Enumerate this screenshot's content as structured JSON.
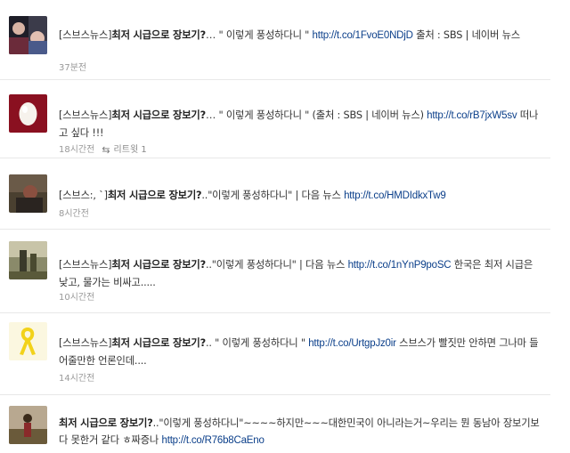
{
  "tweets": [
    {
      "text_before": "[스브스뉴스]",
      "title": "최저 시급으로 장보기?",
      "text_after": "… \" 이렇게 풍성하다니 \" ",
      "link": "http://t.co/1FvoE0NDjD",
      "text_end": " 출처 : SBS | 네이버 뉴스",
      "time": "37분전",
      "retweet": ""
    },
    {
      "text_before": "[스브스뉴스]",
      "title": "최저 시급으로 장보기?",
      "text_after": "… \" 이렇게 풍성하다니 \" (출처 : SBS | 네이버 뉴스) ",
      "link": "http://t.co/rB7jxW5sv",
      "text_end": " 떠나고 싶다 !!!",
      "time": "18시간전",
      "retweet": "리트윗 1"
    },
    {
      "text_before": "[스브스:, `]",
      "title": "최저 시급으로 장보기?",
      "text_after": "..\"이렇게 풍성하다니\" | 다음 뉴스 ",
      "link": "http://t.co/HMDIdkxTw9",
      "text_end": "",
      "time": "8시간전",
      "retweet": ""
    },
    {
      "text_before": "[스브스뉴스]",
      "title": "최저 시급으로 장보기?",
      "text_after": "..\"이렇게 풍성하다니\" | 다음 뉴스 ",
      "link": "http://t.co/1nYnP9poSC",
      "text_end": " 한국은 최저 시급은 낮고, 물가는 비싸고.....",
      "time": "10시간전",
      "retweet": ""
    },
    {
      "text_before": "[스브스뉴스]",
      "title": "최저 시급으로 장보기?",
      "text_after": ".. \" 이렇게 풍성하다니 \" ",
      "link": "http://t.co/UrtgpJz0ir",
      "text_end": " 스브스가 빨짓만 안하면 그나마 들어줄만한 언론인데....",
      "time": "14시간전",
      "retweet": ""
    },
    {
      "text_before": "",
      "title": "최저 시급으로 장보기?",
      "text_after": "..\"이렇게 풍성하다니\"~~~~하지만~~~대한민국이 아니라는거~우리는 뭔 동남아 장보기보다 못한거 같다 ㅎ짜증나 ",
      "link": "http://t.co/R76b8CaEno",
      "text_end": "",
      "time": "",
      "retweet": ""
    }
  ],
  "colors": {
    "link": "#0b3f8a",
    "meta": "#999999",
    "separator": "#e8e8e8"
  }
}
